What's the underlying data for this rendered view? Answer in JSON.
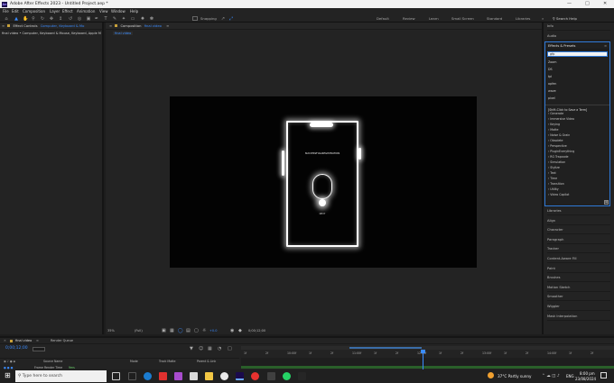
{
  "titlebar": {
    "logo": "Ae",
    "title": "Adobe After Effects 2023 - Untitled Project.aep *"
  },
  "menu": [
    "File",
    "Edit",
    "Composition",
    "Layer",
    "Effect",
    "Animation",
    "View",
    "Window",
    "Help"
  ],
  "toolbar": {
    "snapping_label": "Snapping",
    "workspaces": [
      "Default",
      "Review",
      "Learn",
      "Small Screen",
      "Standard",
      "Libraries"
    ],
    "search_placeholder": "Search Help"
  },
  "left_panel": {
    "tab": "Effect Controls",
    "tab_target": "Computer, Keyboard & Mo",
    "subtitle": "final video • Computer, Keyboard & Mouse, Keyboard, Apple M"
  },
  "comp_panel": {
    "tab": "Composition",
    "tab_target": "final video",
    "sub_tab": "final video",
    "phone_caption": "SUCCESSFULLREGISTRATION",
    "phone_sub": "NEXT",
    "footer": {
      "zoom": "35%",
      "resolution": "(Full)",
      "exposure": "+0.0",
      "timecode": "0;00;12;00"
    }
  },
  "right_panel": {
    "top_items": [
      "Info",
      "Audio"
    ],
    "effects": {
      "title": "Effects & Presets",
      "search_value": "gfp",
      "recent": [
        "Zoom",
        "DS",
        "tpl",
        "opfen",
        "wave",
        "pixel"
      ],
      "save_hint": "[Shift-Click to Save a Term]",
      "categories": [
        "Generate",
        "Immersive Video",
        "Keying",
        "Matte",
        "Noise & Grain",
        "Obsolete",
        "Perspective",
        "PluginEverything",
        "RG Trapcode",
        "Simulation",
        "Stylize",
        "Text",
        "Time",
        "Transition",
        "Utility",
        "Video Copilot"
      ]
    },
    "panels": [
      "Libraries",
      "Align",
      "Character",
      "Paragraph",
      "Tracker",
      "Content-Aware Fill",
      "Paint",
      "Brushes",
      "Motion Sketch",
      "Smoother",
      "Wiggler",
      "Mask Interpolation"
    ]
  },
  "timeline": {
    "tab": "final video",
    "render_tab": "Render Queue",
    "timecode": "0;00;12;00",
    "columns": [
      "Source Name",
      "Mode",
      "Track Matte",
      "Parent & Link"
    ],
    "frame_render_label": "Frame Render Time",
    "frame_render_value": "9ms",
    "ruler": [
      "1f",
      "2f",
      "10:00f",
      "1f",
      "2f",
      "11:00f",
      "1f",
      "2f",
      "12:00f",
      "1f",
      "2f",
      "13:00f",
      "1f",
      "2f",
      "14:00f",
      "1f",
      "2f"
    ]
  },
  "taskbar": {
    "search_placeholder": "Type here to search",
    "weather": "37°C  Partly sunny",
    "lang": "ENG",
    "time": "8:00 pm",
    "date": "23/08/2024"
  }
}
